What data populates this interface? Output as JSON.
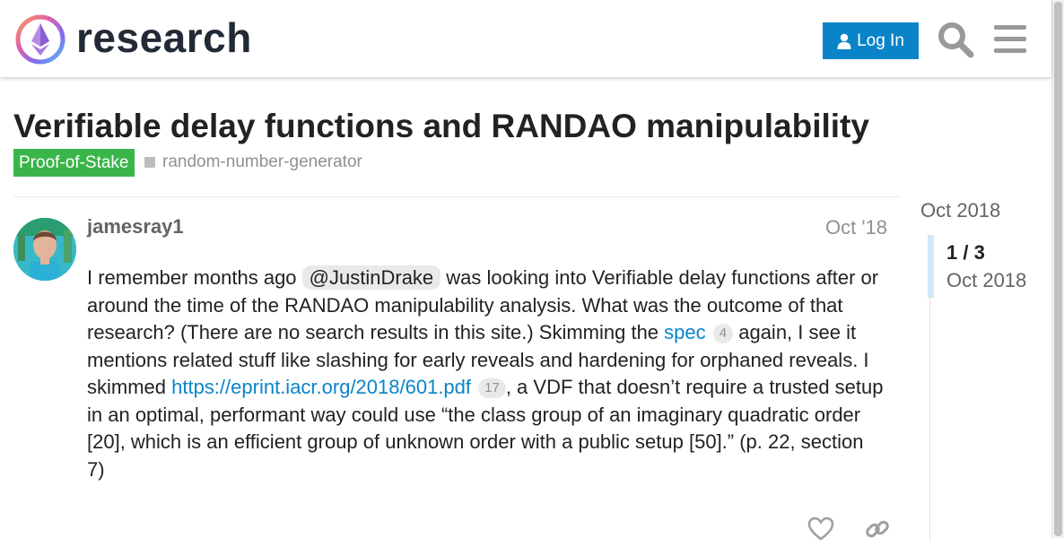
{
  "site": {
    "name": "research"
  },
  "header": {
    "login_label": "Log In"
  },
  "topic": {
    "title": "Verifiable delay functions and RANDAO manipulability",
    "category": "Proof-of-Stake",
    "tag": "random-number-generator"
  },
  "post": {
    "username": "jamesray1",
    "date": "Oct '18",
    "text_1": "I remember months ago ",
    "mention": "@JustinDrake",
    "text_2": " was looking into Verifiable delay functions after or around the time of the RANDAO manipulability analysis. What was the outcome of that research? (There are no search results in this site.) Skimming the ",
    "link_1": "spec",
    "link_1_clicks": "4",
    "text_3": " again, I see it mentions related stuff like slashing for early reveals and hardening for orphaned reveals. I skimmed ",
    "link_2": "https://eprint.iacr.org/2018/601.pdf",
    "link_2_clicks": "17",
    "text_4": ", a VDF that doesn’t require a trusted setup in an optimal, performant way could use “the class group of an imaginary quadratic order [20], which is an efficient group of unknown order with a public setup [50].” (p. 22, section 7)"
  },
  "timeline": {
    "top_date": "Oct 2018",
    "counter": "1 / 3",
    "current_date": "Oct 2018"
  },
  "colors": {
    "accent": "#0a84c8",
    "category": "#3ab54a",
    "muted": "#919191"
  },
  "icons": [
    "ethereum-logo",
    "user-icon",
    "search-icon",
    "hamburger-menu-icon",
    "heart-icon",
    "link-icon"
  ]
}
